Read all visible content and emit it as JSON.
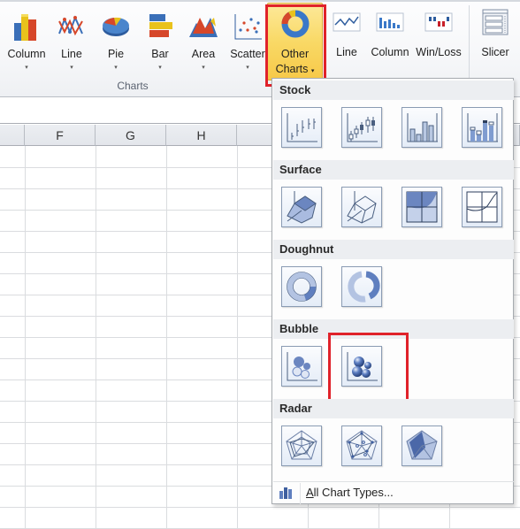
{
  "ribbon": {
    "groups": {
      "charts_label": "Charts"
    },
    "buttons": {
      "column": "Column",
      "line": "Line",
      "pie": "Pie",
      "bar": "Bar",
      "area": "Area",
      "scatter": "Scatter",
      "other_charts_line1": "Other",
      "other_charts_line2": "Charts",
      "dropdown_arrow": "▾"
    },
    "sparklines": {
      "line": "Line",
      "column": "Column",
      "winloss": "Win/Loss"
    },
    "filter": {
      "slicer": "Slicer"
    }
  },
  "sheet": {
    "columns": [
      "",
      "F",
      "G",
      "H",
      ""
    ]
  },
  "dropdown": {
    "sections": [
      {
        "title": "Stock",
        "items": [
          "High-Low-Close",
          "Open-High-Low-Close",
          "Volume-High-Low-Close",
          "Volume-Open-High-Low-Close"
        ]
      },
      {
        "title": "Surface",
        "items": [
          "3-D Surface",
          "Wireframe 3-D Surface",
          "Contour",
          "Wireframe Contour"
        ]
      },
      {
        "title": "Doughnut",
        "items": [
          "Doughnut",
          "Exploded Doughnut"
        ]
      },
      {
        "title": "Bubble",
        "items": [
          "Bubble",
          "Bubble with a 3-D Effect"
        ]
      },
      {
        "title": "Radar",
        "items": [
          "Radar",
          "Radar with Markers",
          "Filled Radar"
        ]
      }
    ],
    "footer": {
      "accelerator": "A",
      "label_rest": "ll Chart Types..."
    },
    "highlighted_item": "Bubble with a 3-D Effect"
  },
  "colors": {
    "highlight": "#e0222a",
    "active_button": "#f9d966",
    "tile_border": "#8a9bb3",
    "icon_blue": "#3f6fb6"
  }
}
